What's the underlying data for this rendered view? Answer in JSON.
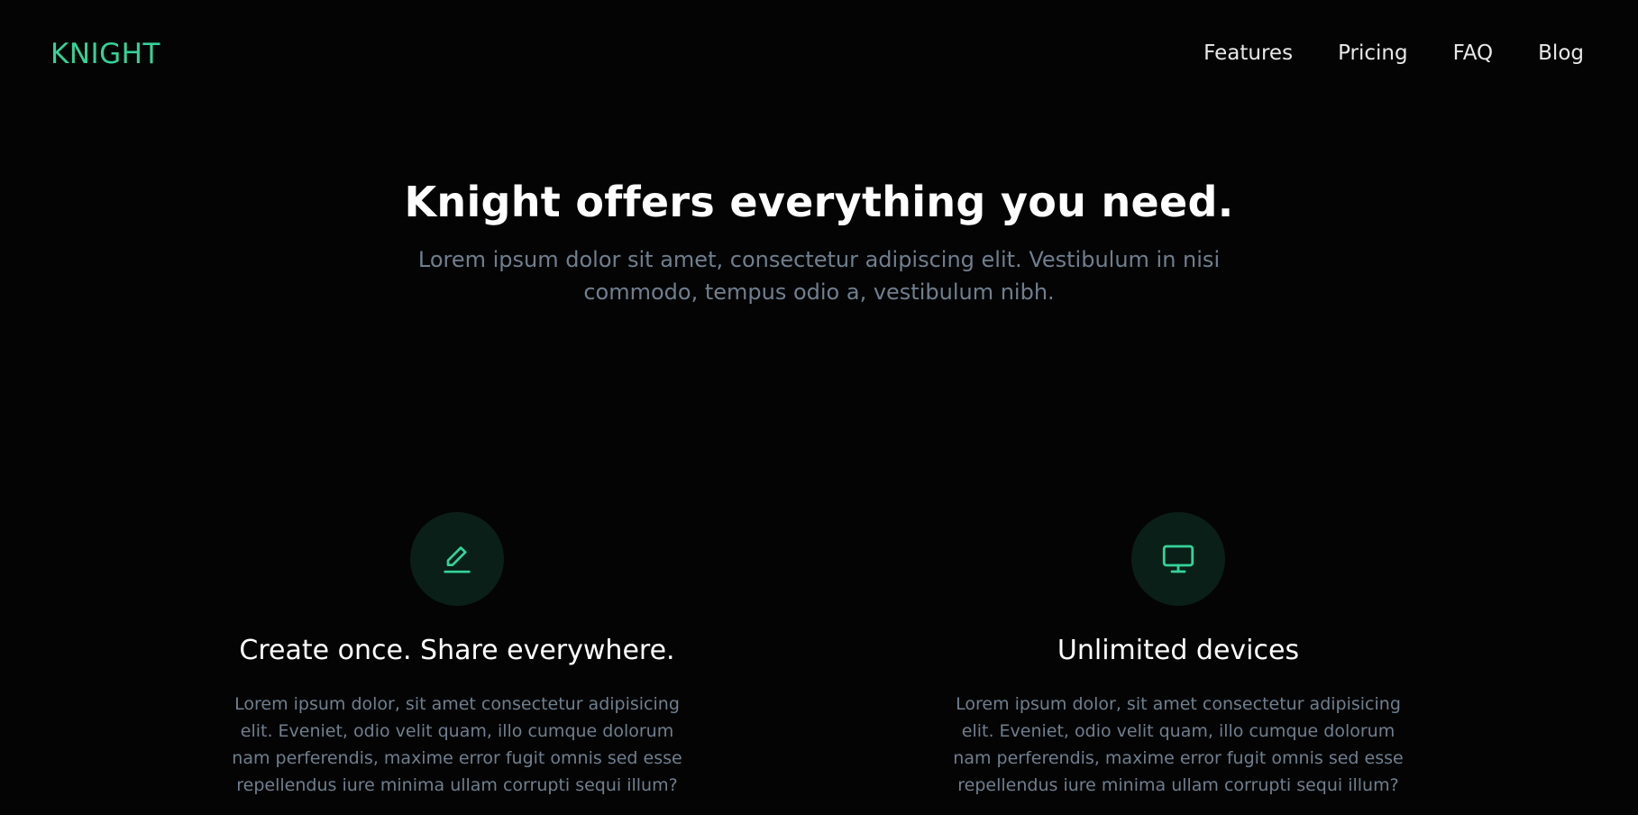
{
  "brand": {
    "name": "KNIGHT",
    "accent_color": "#34d399"
  },
  "nav": {
    "items": [
      {
        "label": "Features"
      },
      {
        "label": "Pricing"
      },
      {
        "label": "FAQ"
      },
      {
        "label": "Blog"
      }
    ]
  },
  "hero": {
    "title": "Knight offers everything you need.",
    "subtitle": "Lorem ipsum dolor sit amet, consectetur adipiscing elit. Vestibulum in nisi commodo, tempus odio a, vestibulum nibh."
  },
  "features": [
    {
      "icon": "pencil-icon",
      "title": "Create once. Share everywhere.",
      "description": "Lorem ipsum dolor, sit amet consectetur adipisicing elit. Eveniet, odio velit quam, illo cumque dolorum nam perferendis, maxime error fugit omnis sed esse repellendus iure minima ullam corrupti sequi illum?"
    },
    {
      "icon": "monitor-icon",
      "title": "Unlimited devices",
      "description": "Lorem ipsum dolor, sit amet consectetur adipisicing elit. Eveniet, odio velit quam, illo cumque dolorum nam perferendis, maxime error fugit omnis sed esse repellendus iure minima ullam corrupti sequi illum?"
    }
  ]
}
